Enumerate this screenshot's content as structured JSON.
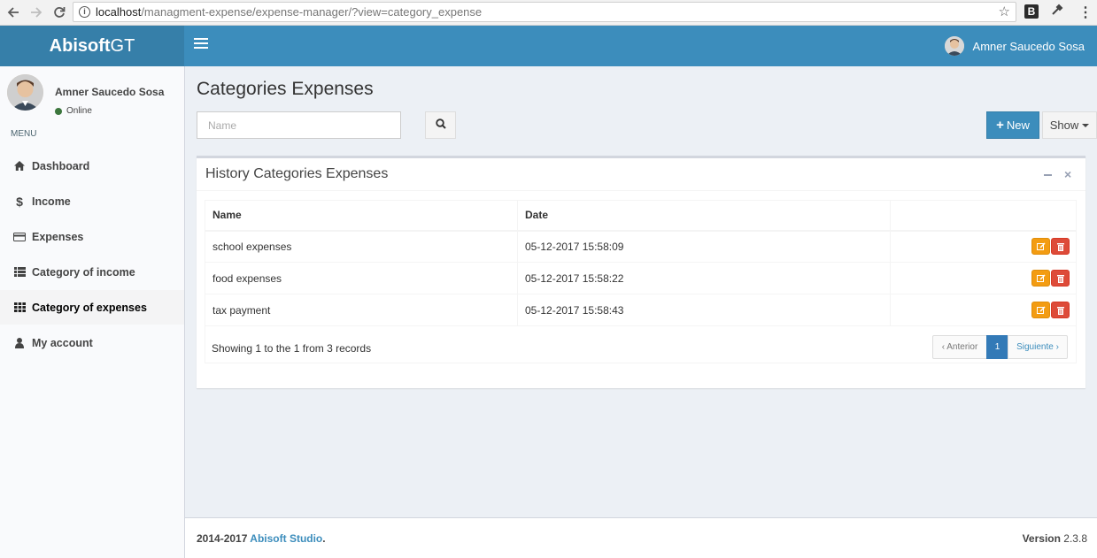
{
  "browser": {
    "url_host": "localhost",
    "url_path": "/managment-expense/expense-manager/?view=category_expense",
    "ext_label": "B"
  },
  "header": {
    "logo_bold": "Abisoft",
    "logo_rest": "GT",
    "user_name": "Amner Saucedo Sosa",
    "brand_color": "#3c8dbc"
  },
  "sidebar": {
    "user_name": "Amner Saucedo Sosa",
    "status": "Online",
    "menu_header": "MENU",
    "items": [
      {
        "label": "Dashboard",
        "icon": "home-icon"
      },
      {
        "label": "Income",
        "icon": "dollar-icon"
      },
      {
        "label": "Expenses",
        "icon": "credit-card-icon"
      },
      {
        "label": "Category of income",
        "icon": "list-icon"
      },
      {
        "label": "Category of expenses",
        "icon": "grid-icon",
        "active": true
      },
      {
        "label": "My account",
        "icon": "user-icon"
      }
    ]
  },
  "main": {
    "title": "Categories Expenses",
    "search_placeholder": "Name",
    "new_label": "New",
    "show_label": "Show",
    "box_title": "History Categories Expenses",
    "table": {
      "headers": [
        "Name",
        "Date",
        ""
      ],
      "rows": [
        {
          "name": "school expenses",
          "date": "05-12-2017 15:58:09"
        },
        {
          "name": "food expenses",
          "date": "05-12-2017 15:58:22"
        },
        {
          "name": "tax payment",
          "date": "05-12-2017 15:58:43"
        }
      ]
    },
    "showing_text": "Showing 1 to the 1 from 3 records",
    "pagination": {
      "prev": "‹ Anterior",
      "current": "1",
      "next": "Siguiente ›"
    }
  },
  "footer": {
    "years": "2014-2017",
    "company": "Abisoft Studio",
    "period": ".",
    "version_label": "Version",
    "version_value": "2.3.8"
  }
}
